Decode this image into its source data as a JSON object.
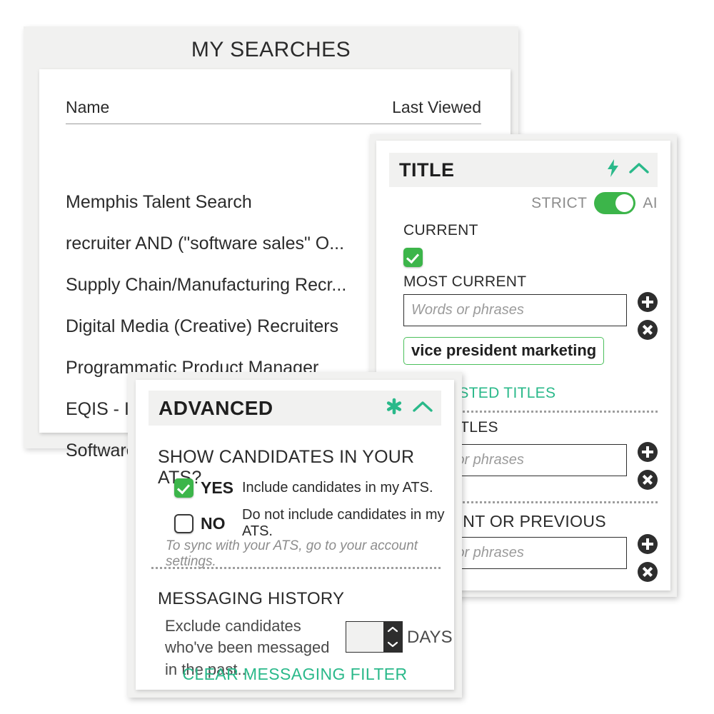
{
  "colors": {
    "accent_teal": "#2ab98a",
    "toggle_green": "#3cb54a",
    "panel_gray": "#f1f1f0",
    "dark": "#2e2e2e"
  },
  "searches_card": {
    "title": "MY SEARCHES",
    "columns": {
      "name": "Name",
      "last_viewed": "Last Viewed"
    },
    "rows": [
      {
        "name": "Memphis Talent Search"
      },
      {
        "name": "recruiter AND (\"software sales\" O..."
      },
      {
        "name": "Supply Chain/Manufacturing Recr..."
      },
      {
        "name": "Digital Media (Creative) Recruiters"
      },
      {
        "name": "Programmatic Product Manager"
      },
      {
        "name": "EQIS - Internal Wholesaler"
      },
      {
        "name": "Software"
      }
    ]
  },
  "title_panel": {
    "header": {
      "title": "TITLE",
      "bolt_icon": "lightning-bolt-icon",
      "collapse_icon": "chevron-up-icon"
    },
    "strict_row": {
      "strict_label": "STRICT",
      "ai_label": "AI",
      "toggle_on": true
    },
    "current_label": "CURRENT",
    "most_current_label": "MOST CURRENT",
    "most_current_input": {
      "value": "",
      "placeholder": "Words or phrases"
    },
    "tag": "vice president marketing",
    "suggested_titles_label": "SUGGESTED TITLES",
    "past_label": "PAST TITLES",
    "past_input": {
      "value": "",
      "placeholder": "Words or phrases"
    },
    "current_or_previous_label": "CURRENT OR PREVIOUS",
    "current_or_previous_input": {
      "value": "",
      "placeholder": "Words or phrases"
    },
    "add_icon": "plus-circle-icon",
    "remove_icon": "x-circle-icon"
  },
  "advanced_panel": {
    "header": {
      "title": "ADVANCED",
      "asterisk_icon": "asterisk-icon",
      "collapse_icon": "chevron-up-icon"
    },
    "question": "SHOW CANDIDATES IN YOUR ATS?",
    "options": [
      {
        "label": "YES",
        "description": "Include candidates in my ATS.",
        "checked": true
      },
      {
        "label": "NO",
        "description": "Do not include candidates in my ATS.",
        "checked": false
      }
    ],
    "sync_note": "To sync with your ATS, go to your account settings.",
    "messaging_history_title": "MESSAGING HISTORY",
    "messaging_text": "Exclude candidates who've been messaged in the past...",
    "days_value": "",
    "days_label": "DAYS",
    "clear_link": "CLEAR MESSAGING FILTER",
    "spinner_up_icon": "chevron-up-icon",
    "spinner_down_icon": "chevron-down-icon"
  }
}
